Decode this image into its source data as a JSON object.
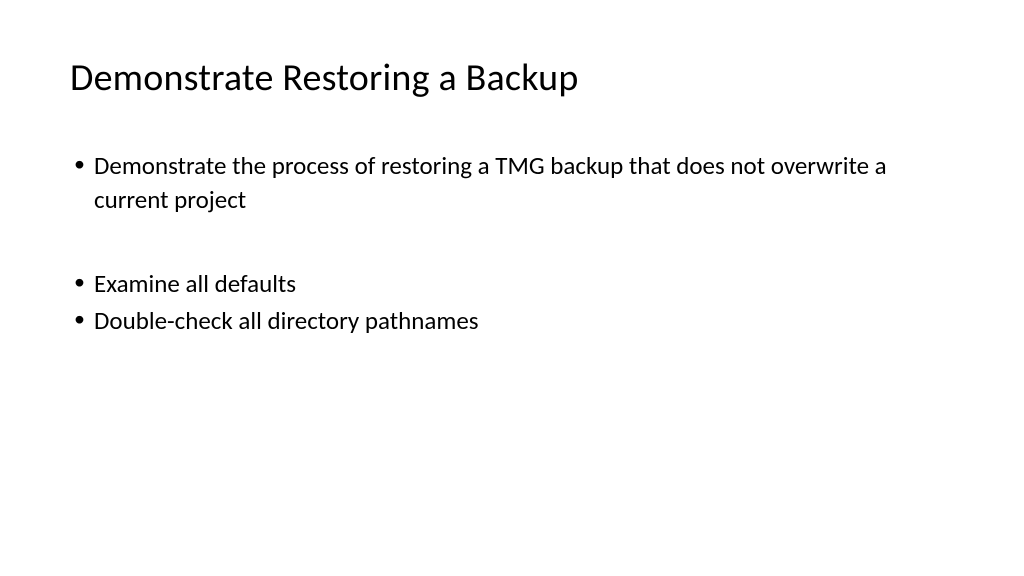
{
  "slide": {
    "title": "Demonstrate Restoring a Backup",
    "bullets": [
      "Demonstrate the process of restoring a TMG backup that does not overwrite a current project",
      "Examine all defaults",
      "Double-check all directory pathnames"
    ]
  }
}
